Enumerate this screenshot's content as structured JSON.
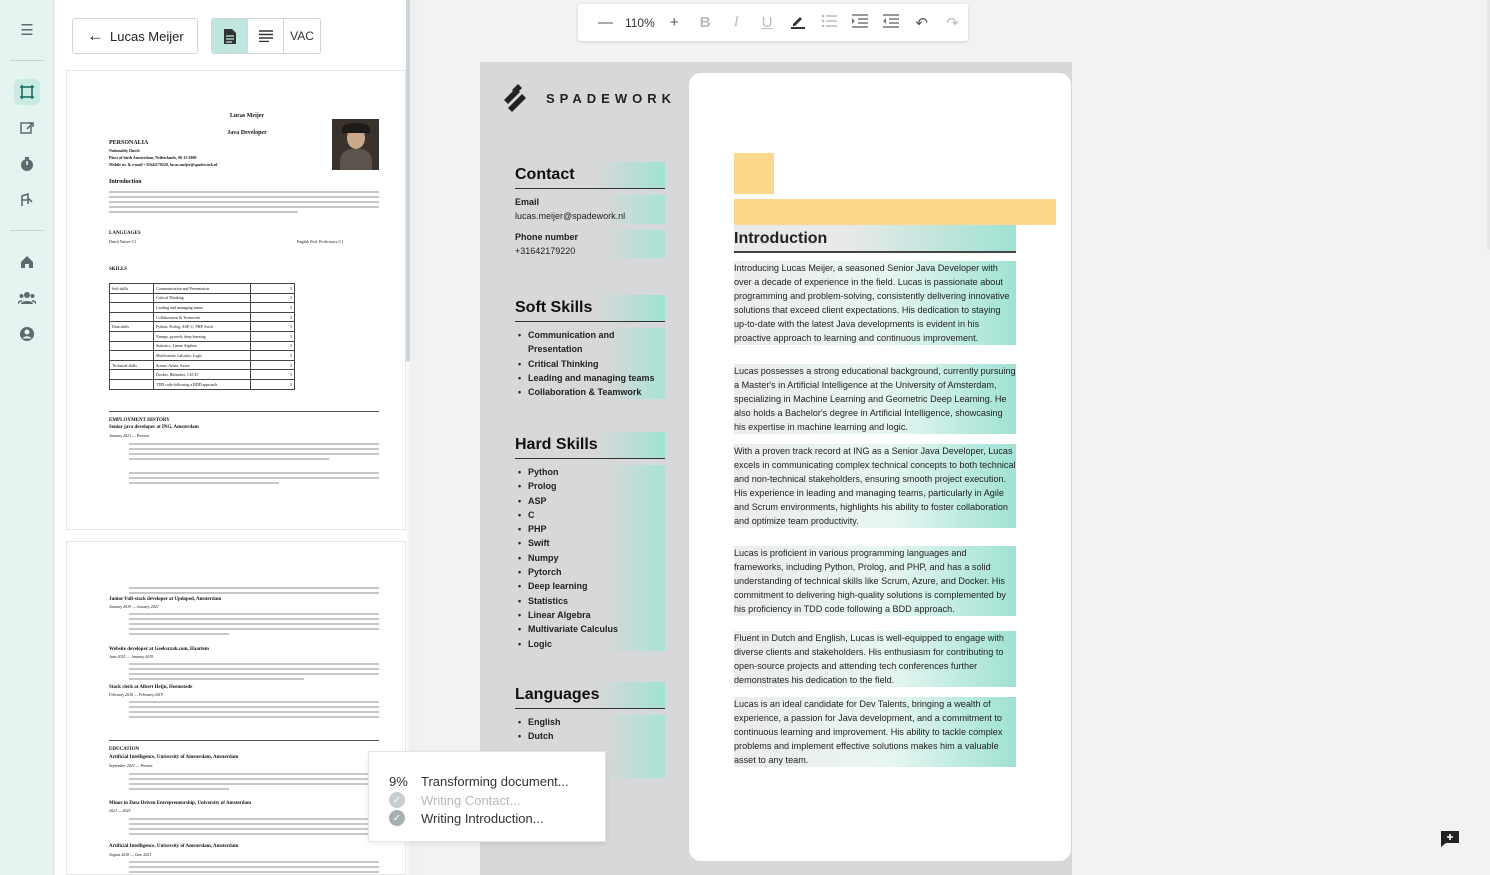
{
  "rail": {
    "icons": [
      "menu-icon",
      "crop-icon",
      "export-icon",
      "timer-icon",
      "tracker-icon",
      "home-icon",
      "team-icon",
      "account-icon"
    ]
  },
  "left": {
    "back_label": "Lucas Meijer",
    "view_toggle": {
      "text_label": "VAC"
    },
    "thumb1": {
      "name": "Lucas Meijer",
      "role": "Java Developer",
      "personalia": "PERSONALIA",
      "nationality": "Nationality Dutch",
      "birth": "Place of birth Amsterdam, Netherlands, 06-11-2000",
      "contact": "Mobile nr. & e-mail +31642179220, lucas.meijer@spadework.nl",
      "intro_h": "Introduction",
      "languages_h": "LANGUAGES",
      "lang_left": "Dutch Native C1",
      "lang_right": "English Prof. Proficiency C1",
      "skills_h": "SKILLS",
      "skills": [
        [
          "Soft skills",
          "Communication and Presentation",
          "3"
        ],
        [
          "",
          "Critical Thinking",
          "3"
        ],
        [
          "",
          "Leading and managing teams",
          "3"
        ],
        [
          "",
          "Collaboration & Teamwork",
          "3"
        ],
        [
          "Data skills",
          "Python, Prolog, ASP, C, PHP, Swift",
          "3"
        ],
        [
          "",
          "Numpy, pytorch, deep learning",
          "3"
        ],
        [
          "",
          "Statistics, Linear Algebra",
          "3"
        ],
        [
          "",
          "Multivariate Calculus, Logic",
          "3"
        ],
        [
          "Technical skills",
          "Scrum, Azure, Azure",
          "3"
        ],
        [
          "",
          "Docker, Bitbucket, CI/CD",
          "3"
        ],
        [
          "",
          "TDD code following a BDD approach",
          "3"
        ]
      ],
      "employment_h": "EMPLOYMENT HISTORY",
      "job1": "Senior java developer at ING, Amsterdam",
      "job1_date": "January 2021 — Present"
    },
    "thumb2": {
      "job2": "Junior Full-stack developer at Updoped, Amsterdam",
      "job2_date": "January 2019 — January 2021",
      "job3": "Website developer at Geeksrzak.com, Haarlem",
      "job3_date": "June 2015 — January 2019",
      "job4": "Stock clerk at Albert Heijn, Heemstede",
      "job4_date": "February 2016 — February 2019",
      "education_h": "EDUCATION",
      "edu1": "Artificial Intelligence, University of Amsterdam, Amsterdam",
      "edu1_date": "September 2021 — Present",
      "edu2": "Minor in Data Driven Entrepreneurship, University of Amsterdam",
      "edu2_date": "2021 — 2023",
      "edu3": "Artificial Intelligence, University of Amsterdam, Amsterdam",
      "edu3_date": "August 2018 — June 2021"
    }
  },
  "toolbar": {
    "zoom": "110%"
  },
  "doc": {
    "brand": "SPADEWORK",
    "contact_h": "Contact",
    "email_label": "Email",
    "email": "lucas.meijer@spadework.nl",
    "phone_label": "Phone number",
    "phone": "+31642179220",
    "soft_h": "Soft Skills",
    "soft": [
      "Communication and Presentation",
      "Critical Thinking",
      "Leading and managing teams",
      "Collaboration & Teamwork"
    ],
    "hard_h": "Hard Skills",
    "hard": [
      "Python",
      "Prolog",
      "ASP",
      "C",
      "PHP",
      "Swift",
      "Numpy",
      "Pytorch",
      "Deep learning",
      "Statistics",
      "Linear Algebra",
      "Multivariate Calculus",
      "Logic"
    ],
    "lang_h": "Languages",
    "langs": [
      "English",
      "Dutch"
    ],
    "intro_h": "Introduction",
    "paras": [
      "Introducing Lucas Meijer, a seasoned Senior Java Developer with over a decade of experience in the field. Lucas is passionate about programming and problem-solving, consistently delivering innovative solutions that exceed client expectations. His dedication to staying up-to-date with the latest Java developments is evident in his proactive approach to learning and continuous improvement.",
      "Lucas possesses a strong educational background, currently pursuing a Master's in Artificial Intelligence at the University of Amsterdam, specializing in Machine Learning and Geometric Deep Learning. He also holds a Bachelor's degree in Artificial Intelligence, showcasing his expertise in machine learning and logic.",
      "With a proven track record at ING as a Senior Java Developer, Lucas excels in communicating complex technical concepts to both technical and non-technical stakeholders, ensuring smooth project execution. His experience in leading and managing teams, particularly in Agile and Scrum environments, highlights his ability to foster collaboration and optimize team productivity.",
      "Lucas is proficient in various programming languages and frameworks, including Python, Prolog, and PHP, and has a solid understanding of technical skills like Scrum, Azure, and Docker. His commitment to delivering high-quality solutions is complemented by his proficiency in TDD code following a BDD approach.",
      "Fluent in Dutch and English, Lucas is well-equipped to engage with diverse clients and stakeholders. His enthusiasm for contributing to open-source projects and attending tech conferences further demonstrates his dedication to the field.",
      "Lucas is an ideal candidate for Dev Talents, bringing a wealth of experience, a passion for Java development, and a commitment to continuous learning and improvement. His ability to tackle complex problems and implement effective solutions makes him a valuable asset to any team."
    ]
  },
  "progress": {
    "percent": "9%",
    "title": "Transforming document...",
    "step1": "Writing Contact...",
    "step2": "Writing Introduction..."
  }
}
